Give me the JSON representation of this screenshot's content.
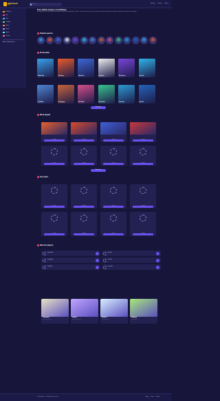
{
  "header": {
    "logo_text": "GETSOLAY",
    "logo_sub": "games",
    "search_placeholder": "Search",
    "links": [
      "Settings",
      "Contact",
      "Sign in"
    ]
  },
  "sidebar": {
    "items": [
      {
        "label": "Discovery",
        "color": "#f5b400"
      },
      {
        "label": "Hot",
        "color": "#ff4d6d"
      },
      {
        "label": "New",
        "color": "#4fc3f7"
      },
      {
        "label": "Trending",
        "color": "#7cda5a"
      },
      {
        "label": "Action",
        "color": "#ff8a3d"
      },
      {
        "label": "Puzzle",
        "color": "#b388ff"
      },
      {
        "label": "Sports",
        "color": "#64ffda"
      },
      {
        "label": "Driving",
        "color": "#ff6e9c"
      }
    ],
    "extra": "About GetSolay Games"
  },
  "intro": {
    "title": "Free Online Games on GetSolay",
    "text": "Play hundreds of free online games instantly in your browser. No downloads, no installs — discover action, puzzle, racing, sports and many more categories, updated every day with new titles for every player."
  },
  "sections": {
    "popular_genres": "Popular genres",
    "first_row": "Fresh picks",
    "most_played": "Most played",
    "top_rated": "Top rated",
    "popular_now": "Popular now",
    "more_button": "More games",
    "list_section": "New for players"
  },
  "grid_games": [
    {
      "name": "Roblox Obby",
      "color": "#3aa0e8"
    },
    {
      "name": "Fire Runner",
      "color": "#e85b2c"
    },
    {
      "name": "Skate Rush",
      "color": "#3d68d6"
    },
    {
      "name": "Word Hunt",
      "color": "#eeeeee"
    },
    {
      "name": "Block Tycoon",
      "color": "#7a46d8"
    },
    {
      "name": "Pet Party",
      "color": "#2fb6e8"
    },
    {
      "name": "City Builder",
      "color": "#4e86d3"
    },
    {
      "name": "Car Rampage",
      "color": "#c8643a"
    },
    {
      "name": "Pixel World",
      "color": "#d54f8a"
    },
    {
      "name": "Block Puzzle",
      "color": "#38c48f"
    },
    {
      "name": "Ocean Tap",
      "color": "#2c9bd3"
    },
    {
      "name": "Sky Pilot",
      "color": "#2563b8"
    }
  ],
  "featured_games": [
    {
      "name": "Fire Crazy",
      "color": "#e8602b"
    },
    {
      "name": "Fast Traffic Jam",
      "color": "#d84a2c"
    },
    {
      "name": "Fruit Crush",
      "color": "#3f5fd6"
    },
    {
      "name": "BL.ODANE",
      "color": "#c9383b"
    }
  ],
  "loading_games": [
    "Lazy Cube",
    "New Sandbox Boom",
    "Ludo Monster",
    "Slidery",
    "Blossom",
    "Tap It Up",
    "Stitch Ninja Road",
    "Arena Dash",
    "Candy Path",
    "Fruit Merge",
    "Maze Drift",
    "Pixel Spin",
    "Tile Toss",
    "Bounce Lab",
    "Rope Hero",
    "Jump Dots"
  ],
  "play_label": "Play now",
  "list_games": [
    "Tower Battle",
    "Gem Run",
    "Lucky Hoops",
    "Tiny Golf",
    "Snake King",
    "Lemon Fall"
  ],
  "promos": [
    {
      "title": "Crossword",
      "desc": "Daily word challenge",
      "color": "#e8e2c4"
    },
    {
      "title": "Sudoku",
      "desc": "Classic number puzzle",
      "color": "#c0a6ff"
    },
    {
      "title": "Solitaire",
      "desc": "Card game classic",
      "color": "#d8f0ff"
    },
    {
      "title": "Mahjong",
      "desc": "Match the tiles",
      "color": "#a8e87a"
    }
  ],
  "footer": {
    "copyright": "GetSolay Games © 2024. All rights reserved.",
    "links": [
      "Privacy",
      "Terms",
      "Contact"
    ]
  }
}
